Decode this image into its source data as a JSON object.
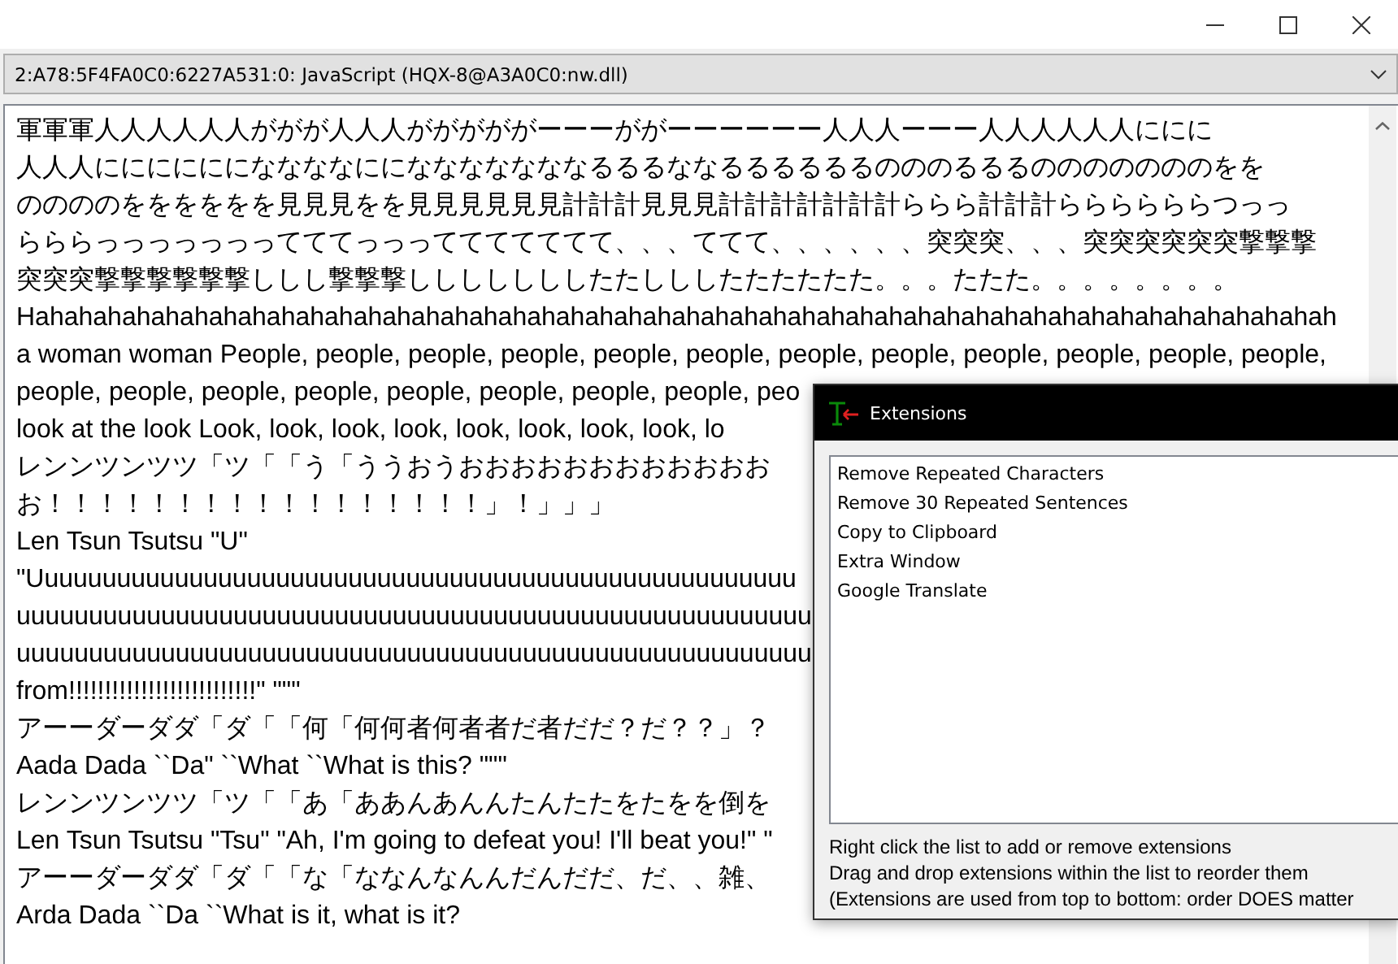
{
  "process_selector": {
    "value": "2:A78:5F4FA0C0:6227A531:0: JavaScript (HQX-8@A3A0C0:nw.dll)"
  },
  "text_output": {
    "lines": [
      "軍軍軍人人人人人人ががが人人人がががががーーーががーーーーーー人人人ーーー人人人人人人ににに",
      "人人人ににににににななななにになななななななるるるななるるるるるるのののるるるのののののののをを",
      "ののののをををををを見見見をを見見見見見見計計計見見見計計計計計計計ららら計計計ららららららつっっ",
      "らららっっっっっっってててっっっててててててて、、、ててて、、、、、、突突突、、、突突突突突突撃撃撃",
      "突突突撃撃撃撃撃撃ししし撃撃撃しししししししたたしししたたたたたた。。。たたた。。。。。。。。",
      "Hahahahahahahahahahahahahahahahahahahahahahahahahahahahahahahahahahahahahahahahahahahahahah",
      "a woman woman People, people, people, people, people, people, people, people, people, people, people, people,",
      "people, people, people, people, people, people, people, people, peo",
      "look at the look Look, look, look, look, look, look, look, look, lo",
      "レンンツンツツ「ツ「「う「ううおうおおおおおおおおおおおお",
      "お！！！！！！！！！！！！！！！！！」！」」」",
      "Len Tsun Tsutsu \"U\"",
      "\"Uuuuuuuuuuuuuuuuuuuuuuuuuuuuuuuuuuuuuuuuuuuuuuuuuuuuu",
      "uuuuuuuuuuuuuuuuuuuuuuuuuuuuuuuuuuuuuuuuuuuuuuuuuuuuuuu",
      "uuuuuuuuuuuuuuuuuuuuuuuuuuuuuuuuuuuuuuuuuuuuuuuuuuuuuuu",
      "from!!!!!!!!!!!!!!!!!!!!!!!!!!\" \"\"\"",
      "アーーダーダダ「ダ「「何「何何者何者者だ者だだ？だ？？」？",
      "Aada Dada ``Da\" ``What ``What is this? \"\"\"",
      "レンンツンツツ「ツ「「あ「ああんあんんたんたたをたをを倒を",
      "Len Tsun Tsutsu \"Tsu\" \"Ah, I'm going to defeat you! I'll beat you!\" \"",
      "アーーダーダダ「ダ「「な「ななんなんんだんだだ、だ、、雑、",
      "Arda Dada ``Da ``What is it, what is it?"
    ]
  },
  "extensions_window": {
    "title": "Extensions",
    "items": [
      "Remove Repeated Characters",
      "Remove 30 Repeated Sentences",
      "Copy to Clipboard",
      "Extra Window",
      "Google Translate"
    ],
    "instructions": [
      "Right click the list to add or remove extensions",
      "Drag and drop extensions within the list to reorder them",
      "(Extensions are used from top to bottom: order DOES matter"
    ]
  }
}
